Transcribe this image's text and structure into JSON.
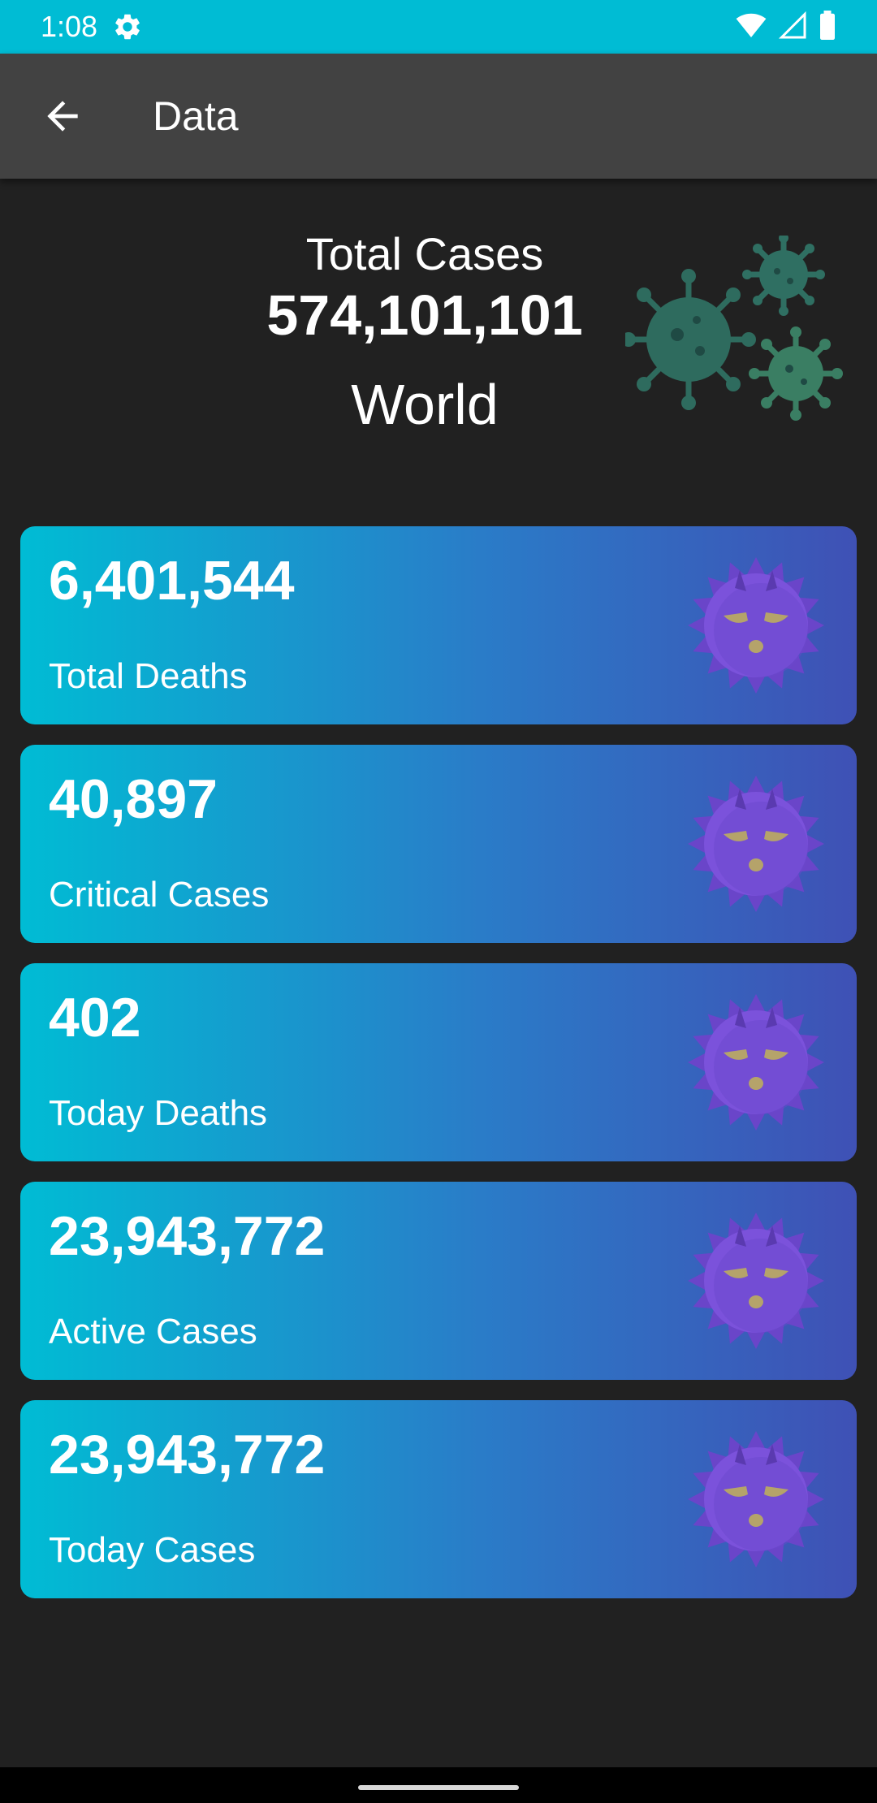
{
  "status_bar": {
    "time": "1:08",
    "icons": [
      "settings-gear-icon",
      "wifi-icon",
      "cell-signal-icon",
      "battery-icon"
    ],
    "background": "#00BCD4"
  },
  "app_bar": {
    "title": "Data",
    "back_icon": "arrow-back-icon",
    "background": "#424242"
  },
  "summary": {
    "label": "Total Cases",
    "value": "574,101,101",
    "region": "World"
  },
  "cards": [
    {
      "value": "6,401,544",
      "label": "Total Deaths"
    },
    {
      "value": "40,897",
      "label": "Critical Cases"
    },
    {
      "value": "402",
      "label": "Today Deaths"
    },
    {
      "value": "23,943,772",
      "label": "Active Cases"
    },
    {
      "value": "23,943,772",
      "label": "Today Cases"
    }
  ],
  "colors": {
    "page_background": "#212121",
    "card_gradient_start": "#00BCD4",
    "card_gradient_end": "#3F51B5",
    "virus_cluster": "#2E6B5E",
    "card_icon": "#7B4FD6"
  }
}
